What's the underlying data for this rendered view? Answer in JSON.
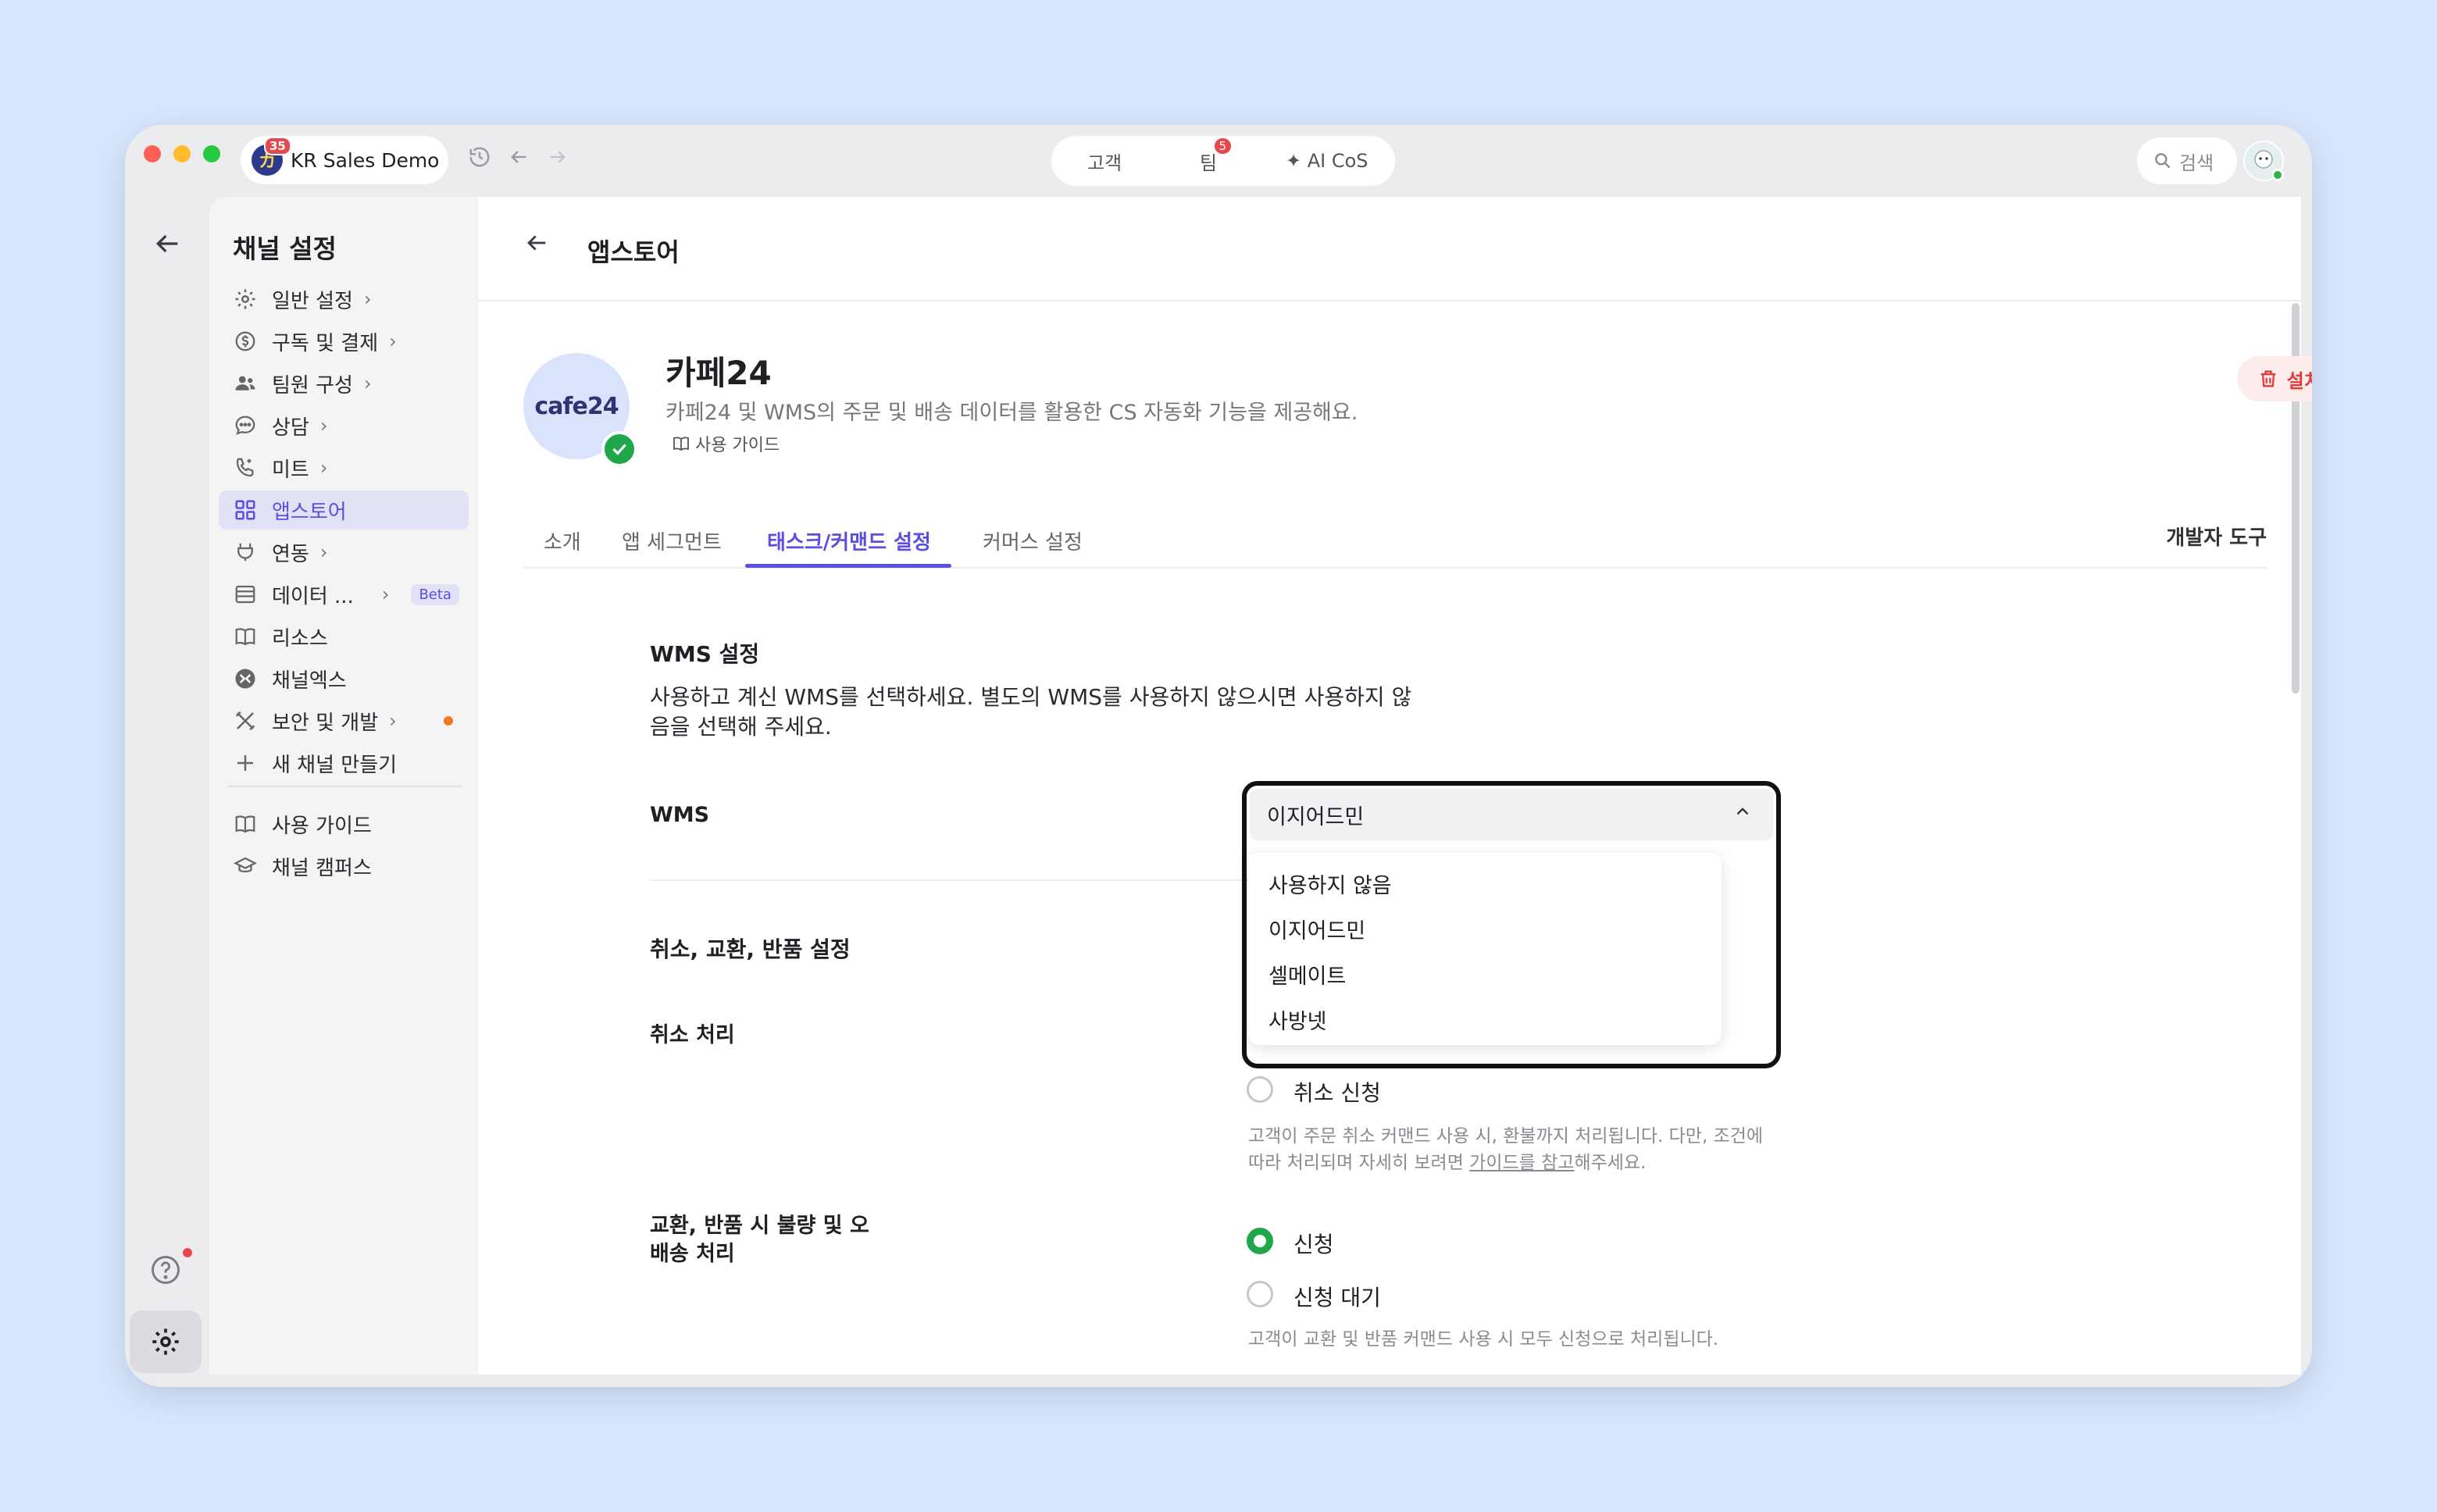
{
  "titlebar": {
    "workspace": {
      "name": "KR Sales Demo",
      "badge": "35",
      "logo_glyph": "カ"
    },
    "center_tabs": [
      {
        "label": "고객",
        "badge": ""
      },
      {
        "label": "팀",
        "badge": "5"
      },
      {
        "label": "✦ AI CoS",
        "badge": ""
      }
    ],
    "search_label": "검색"
  },
  "sidenav": {
    "title": "채널 설정",
    "items": [
      {
        "label": "일반 설정",
        "icon": "gear-icon"
      },
      {
        "label": "구독 및 결제",
        "icon": "dollar-icon"
      },
      {
        "label": "팀원 구성",
        "icon": "people-icon"
      },
      {
        "label": "상담",
        "icon": "chat-icon"
      },
      {
        "label": "미트",
        "icon": "phone-icon"
      },
      {
        "label": "앱스토어",
        "icon": "grid-icon"
      },
      {
        "label": "연동",
        "icon": "plug-icon"
      },
      {
        "label": "데이터 ...",
        "icon": "table-icon",
        "badge": "Beta"
      },
      {
        "label": "리소스",
        "icon": "book-icon"
      },
      {
        "label": "채널엑스",
        "icon": "channelx-icon"
      },
      {
        "label": "보안 및 개발",
        "icon": "tools-icon"
      },
      {
        "label": "새 채널 만들기",
        "icon": "plus-icon"
      },
      {
        "label": "사용 가이드",
        "icon": "book-icon"
      },
      {
        "label": "채널 캠퍼스",
        "icon": "graduation-icon"
      }
    ]
  },
  "main": {
    "header_title": "앱스토어",
    "app": {
      "logo_text": "cafe24",
      "name": "카페24",
      "description": "카페24 및 WMS의 주문 및 배송 데이터를 활용한 CS 자동화 기능을 제공해요.",
      "guide_label": "사용 가이드",
      "uninstall_label": "설치 해제"
    },
    "tabs": [
      "소개",
      "앱 세그먼트",
      "태스크/커맨드 설정",
      "커머스 설정"
    ],
    "dev_tools_label": "개발자 도구",
    "wms": {
      "title": "WMS 설정",
      "description": "사용하고 계신 WMS를 선택하세요. 별도의 WMS를 사용하지 않으시면 사용하지 않음을 선택해 주세요.",
      "label": "WMS",
      "selected": "이지어드민",
      "options": [
        "사용하지 않음",
        "이지어드민",
        "셀메이트",
        "사방넷"
      ]
    },
    "cancel_section": {
      "title": "취소, 교환, 반품 설정",
      "cancel_label": "취소 처리",
      "cancel_option": "취소 신청",
      "cancel_hint_a": "고객이 주문 취소 커맨드 사용 시, 환불까지 처리됩니다. 다만, 조건에 따라 처리되며 자세히 보려면 ",
      "cancel_hint_link": "가이드를 참고",
      "cancel_hint_b": "해주세요.",
      "exchange_label": "교환, 반품 시 불량 및 오배송 처리",
      "exchange_options": [
        "신청",
        "신청 대기"
      ],
      "exchange_hint": "고객이 교환 및 반품 커맨드 사용 시 모두 신청으로 처리됩니다."
    }
  }
}
